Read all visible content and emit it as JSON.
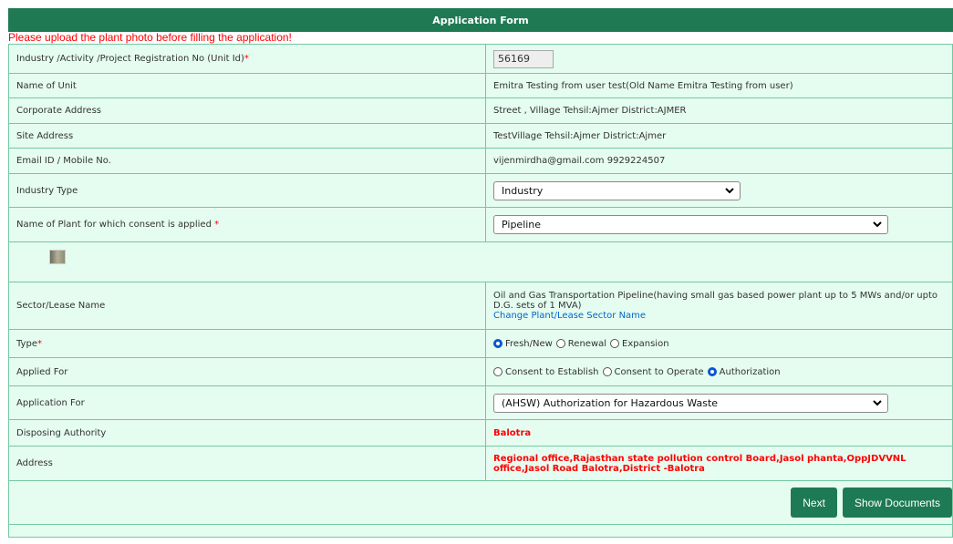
{
  "form": {
    "title": "Application Form",
    "warning": "Please upload the plant photo before filling the application!"
  },
  "rows": {
    "unit_id": {
      "label": "Industry /Activity /Project Registration No (Unit Id)",
      "required_mark": "*",
      "value": "56169"
    },
    "unit_name": {
      "label": "Name of Unit",
      "value": "Emitra Testing from user test(Old Name Emitra Testing from user)"
    },
    "corporate_address": {
      "label": "Corporate Address",
      "value": "Street , Village Tehsil:Ajmer District:AJMER"
    },
    "site_address": {
      "label": "Site Address",
      "value": "TestVillage Tehsil:Ajmer District:Ajmer"
    },
    "email_mobile": {
      "label": "Email ID / Mobile No.",
      "value": "vijenmirdha@gmail.com 9929224507"
    },
    "industry_type": {
      "label": "Industry Type",
      "selected": "Industry"
    },
    "plant_name": {
      "label": "Name of Plant for which consent is applied",
      "required_mark": "*",
      "selected": "Pipeline"
    },
    "sector": {
      "label": "Sector/Lease Name",
      "value": "Oil and Gas Transportation Pipeline(having small gas based power plant up to 5 MWs and/or upto D.G. sets of 1 MVA)",
      "link": "Change Plant/Lease Sector Name"
    },
    "type": {
      "label": "Type",
      "required_mark": "*",
      "options": [
        "Fresh/New",
        "Renewal",
        "Expansion"
      ],
      "selected": "Fresh/New"
    },
    "applied_for": {
      "label": "Applied For",
      "options": [
        "Consent to Establish",
        "Consent to Operate",
        "Authorization"
      ],
      "selected": "Authorization"
    },
    "application_for": {
      "label": "Application For",
      "selected": "(AHSW) Authorization for Hazardous Waste"
    },
    "disposing_authority": {
      "label": "Disposing Authority",
      "value": "Balotra"
    },
    "address": {
      "label": "Address",
      "value": "Regional office,Rajasthan state pollution control Board,Jasol phanta,OppJDVVNL office,Jasol Road Balotra,District -Balotra"
    }
  },
  "buttons": {
    "next": "Next",
    "show_documents": "Show Documents"
  },
  "colors": {
    "header": "#1f7a54",
    "row_bg": "#e5fcf0",
    "border": "#74c8a2",
    "warning": "#ff0000",
    "button": "#1e7a54",
    "link": "#0066cc"
  }
}
